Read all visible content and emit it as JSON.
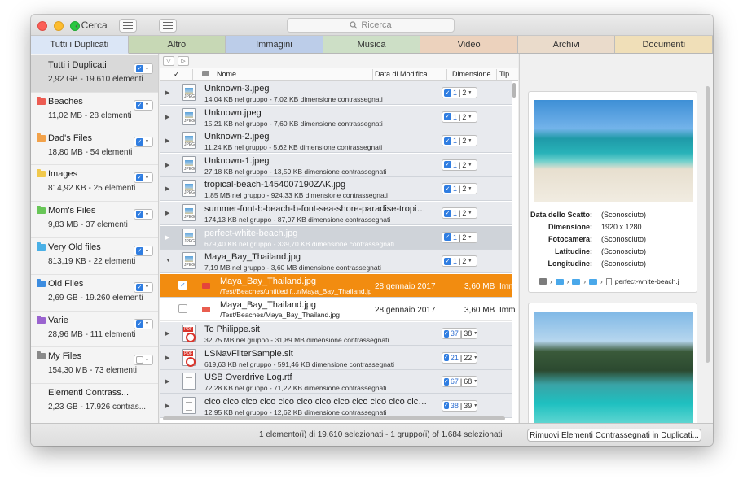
{
  "titlebar": {
    "back_label": "Cerca",
    "search_placeholder": "Ricerca"
  },
  "tabs": [
    {
      "label": "Tutti i Duplicati",
      "color": "#dbe6f6"
    },
    {
      "label": "Altro",
      "color": "#c7d8b5"
    },
    {
      "label": "Immagini",
      "color": "#bccde9"
    },
    {
      "label": "Musica",
      "color": "#cddfc6"
    },
    {
      "label": "Video",
      "color": "#ecd2bd"
    },
    {
      "label": "Archivi",
      "color": "#eadbcb"
    },
    {
      "label": "Documenti",
      "color": "#f0dfb8"
    }
  ],
  "sidebar": {
    "items": [
      {
        "name": "Tutti i Duplicati",
        "sub": "2,92 GB - 19.610 elementi",
        "folder_color": "",
        "checked": true,
        "selected": true
      },
      {
        "name": "Beaches",
        "sub": "11,02 MB - 28 elementi",
        "folder_color": "#ec5c52",
        "checked": true
      },
      {
        "name": "Dad's Files",
        "sub": "18,80 MB - 54 elementi",
        "folder_color": "#f2a24a",
        "checked": true
      },
      {
        "name": "Images",
        "sub": "814,92 KB - 25 elementi",
        "folder_color": "#f1c94d",
        "checked": true
      },
      {
        "name": "Mom's Files",
        "sub": "9,83 MB - 37 elementi",
        "folder_color": "#68c657",
        "checked": true
      },
      {
        "name": "Very Old files",
        "sub": "813,19 KB - 22 elementi",
        "folder_color": "#4ab0e6",
        "checked": true
      },
      {
        "name": "Old Files",
        "sub": "2,69 GB - 19.260 elementi",
        "folder_color": "#3d8de0",
        "checked": true
      },
      {
        "name": "Varie",
        "sub": "28,96 MB - 111 elementi",
        "folder_color": "#9a63cf",
        "checked": true
      },
      {
        "name": "My Files",
        "sub": "154,30 MB - 73 elementi",
        "folder_color": "#8a8a8a",
        "checked": false
      },
      {
        "name": "Elementi Contrass...",
        "sub": "2,23 GB - 17.926 contras...",
        "folder_color": "",
        "checked": null
      }
    ]
  },
  "list": {
    "columns": {
      "name": "Nome",
      "date": "Data di Modifica",
      "size": "Dimensione",
      "type": "Tip"
    },
    "groups": [
      {
        "name": "Unknown-3.jpeg",
        "info": "14,04 KB nel gruppo - 7,02 KB dimensione contrassegnati",
        "icon": "jpeg",
        "n": "1",
        "total": "2"
      },
      {
        "name": "Unknown.jpeg",
        "info": "15,21 KB nel gruppo - 7,60 KB dimensione contrassegnati",
        "icon": "jpeg",
        "n": "1",
        "total": "2"
      },
      {
        "name": "Unknown-2.jpeg",
        "info": "11,24 KB nel gruppo - 5,62 KB dimensione contrassegnati",
        "icon": "jpeg",
        "n": "1",
        "total": "2"
      },
      {
        "name": "Unknown-1.jpeg",
        "info": "27,18 KB nel gruppo - 13,59 KB dimensione contrassegnati",
        "icon": "jpeg",
        "n": "1",
        "total": "2"
      },
      {
        "name": "tropical-beach-1454007190ZAK.jpg",
        "info": "1,85 MB nel gruppo - 924,33 KB dimensione contrassegnati",
        "icon": "jpeg",
        "n": "1",
        "total": "2"
      },
      {
        "name": "summer-font-b-beach-b-font-sea-shore-paradise-tropical-font...",
        "info": "174,13 KB nel gruppo - 87,07 KB dimensione contrassegnati",
        "icon": "jpeg",
        "n": "1",
        "total": "2"
      },
      {
        "name": "perfect-white-beach.jpg",
        "info": "679,40 KB nel gruppo - 339,70 KB dimensione contrassegnati",
        "icon": "jpeg",
        "n": "1",
        "total": "2",
        "selected": true
      },
      {
        "name": "Maya_Bay_Thailand.jpg",
        "info": "7,19 MB nel gruppo - 3,60 MB dimensione contrassegnati",
        "icon": "jpeg",
        "n": "1",
        "total": "2",
        "expanded": true
      }
    ],
    "files": [
      {
        "name": "Maya_Bay_Thailand.jpg",
        "path": "/Test/Beaches/untitled f...r/Maya_Bay_Thailand.jpg",
        "date": "28 gennaio 2017",
        "size": "3,60 MB",
        "type": "Imm",
        "checked": true,
        "highlight": true
      },
      {
        "name": "Maya_Bay_Thailand.jpg",
        "path": "/Test/Beaches/Maya_Bay_Thailand.jpg",
        "date": "28 gennaio 2017",
        "size": "3,60 MB",
        "type": "Imm",
        "checked": false
      }
    ],
    "groups2": [
      {
        "name": "To Philippe.sit",
        "info": "32,75 MB nel gruppo - 31,89 MB dimensione contrassegnati",
        "icon": "pdf",
        "n": "37",
        "total": "38"
      },
      {
        "name": "LSNavFilterSample.sit",
        "info": "619,63 KB nel gruppo - 591,46 KB dimensione contrassegnati",
        "icon": "pdf",
        "n": "21",
        "total": "22"
      },
      {
        "name": "USB Overdrive Log.rtf",
        "info": "72,28 KB nel gruppo - 71,22 KB dimensione contrassegnati",
        "icon": "doc",
        "n": "67",
        "total": "68"
      },
      {
        "name": "cico cico cico cico cico cico cico cico cico cico cico cico ci...",
        "info": "12,95 KB nel gruppo - 12,62 KB dimensione contrassegnati",
        "icon": "doc",
        "n": "38",
        "total": "39"
      }
    ]
  },
  "preview": {
    "meta": [
      {
        "key": "Data dello Scatto:",
        "value": "(Sconosciuto)"
      },
      {
        "key": "Dimensione:",
        "value": "1920 x 1280"
      },
      {
        "key": "Fotocamera:",
        "value": "(Sconosciuto)"
      },
      {
        "key": "Latitudine:",
        "value": "(Sconosciuto)"
      },
      {
        "key": "Longitudine:",
        "value": "(Sconosciuto)"
      }
    ],
    "path_file": "perfect-white-beach.j"
  },
  "status": {
    "text": "1 elemento(i) di 19.610 selezionati - 1 gruppo(i) of 1.684 selezionati",
    "remove_button": "Rimuovi Elementi Contrassegnati in Duplicati..."
  }
}
